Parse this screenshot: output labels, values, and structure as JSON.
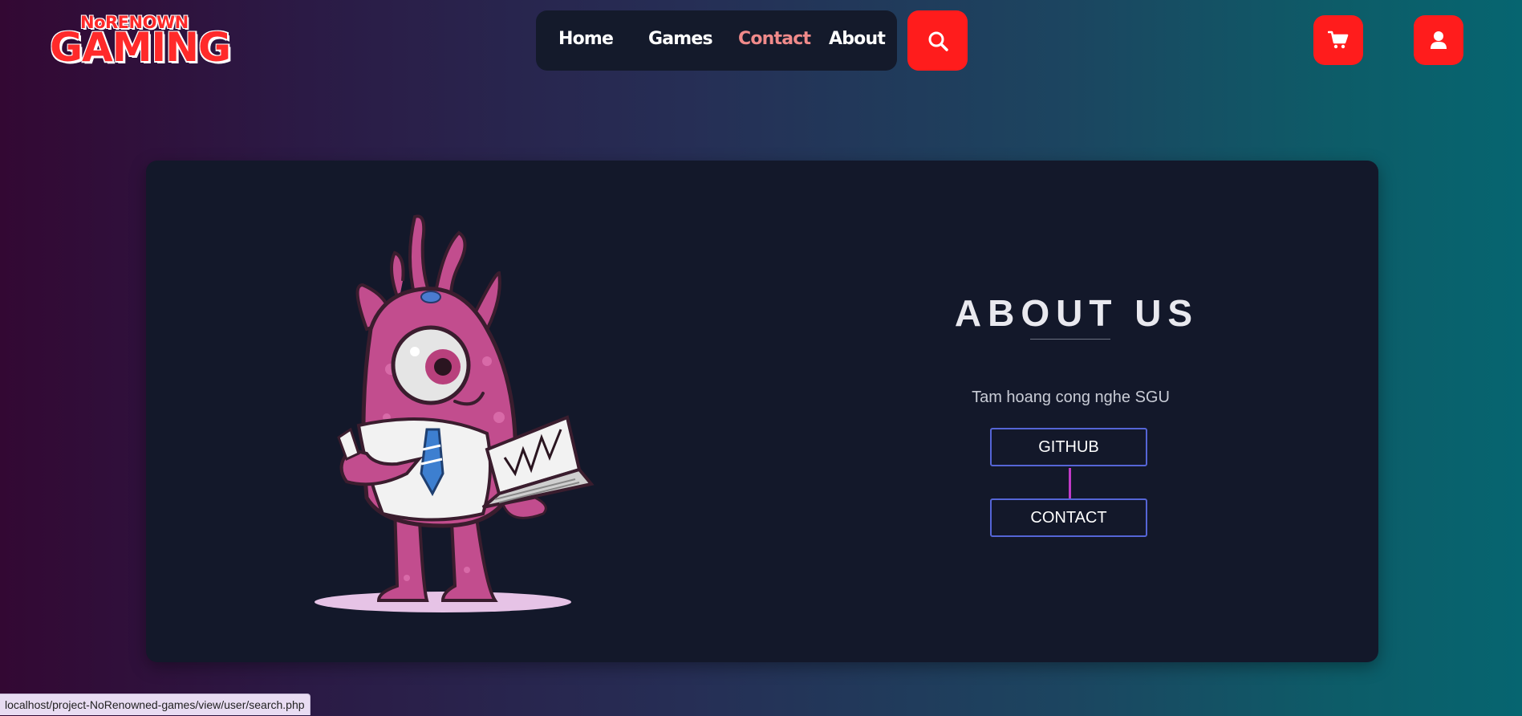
{
  "brand": {
    "top_line": "NoRENOWN",
    "main_line": "GAMING",
    "color": "#ff2a2a"
  },
  "nav": {
    "items": [
      {
        "label": "Home",
        "active": false
      },
      {
        "label": "Games",
        "active": false
      },
      {
        "label": "Contact",
        "active": true
      },
      {
        "label": "About",
        "active": false
      }
    ],
    "search_icon": "search-icon"
  },
  "header_actions": {
    "cart_icon": "cart-icon",
    "user_icon": "user-icon"
  },
  "about": {
    "title": "ABOUT US",
    "tagline": "Tam hoang cong nghe SGU",
    "github_label": "GITHUB",
    "contact_label": "CONTACT"
  },
  "status_bar": {
    "url": "localhost/project-NoRenowned-games/view/user/search.php"
  },
  "colors": {
    "accent": "#ff1c1c",
    "card_bg": "#13182a",
    "button_border": "#5565d6",
    "connector": "#c13ac8"
  }
}
